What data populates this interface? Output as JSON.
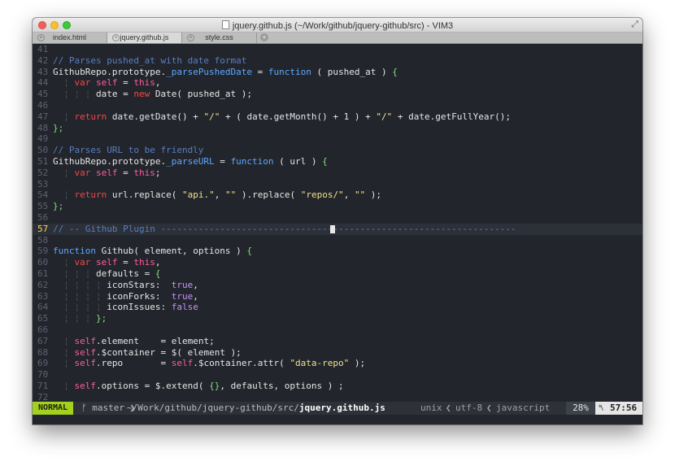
{
  "window": {
    "title": "jquery.github.js (~/Work/github/jquery-github/src) - VIM3"
  },
  "tabs": [
    {
      "label": "index.html"
    },
    {
      "label": "jquery.github.js"
    },
    {
      "label": "style.css"
    }
  ],
  "lines": [
    {
      "num": "41",
      "html": ""
    },
    {
      "num": "42",
      "html": "<span class=\"cmt\">// Parses pushed_at with date format</span>"
    },
    {
      "num": "43",
      "html": "GithubRepo.prototype.<span class=\"fn\">_parsePushedDate</span> = <span class=\"fn\">function</span> ( pushed_at ) <span class=\"brace\">{</span>"
    },
    {
      "num": "44",
      "html": "<span class=\"guide\">  ¦ </span><span class=\"kw\">var</span> <span class=\"self\">self</span> = <span class=\"self\">this</span>,"
    },
    {
      "num": "45",
      "html": "<span class=\"guide\">  ¦ ¦ ¦ </span>date = <span class=\"kw\">new</span> Date( pushed_at );"
    },
    {
      "num": "46",
      "html": ""
    },
    {
      "num": "47",
      "html": "<span class=\"guide\">  ¦ </span><span class=\"kw\">return</span> date.getDate() + <span class=\"str\">\"/\"</span> + ( date.getMonth() + 1 ) + <span class=\"str\">\"/\"</span> + date.getFullYear();"
    },
    {
      "num": "48",
      "html": "<span class=\"brace\">};</span>"
    },
    {
      "num": "49",
      "html": ""
    },
    {
      "num": "50",
      "html": "<span class=\"cmt\">// Parses URL to be friendly</span>"
    },
    {
      "num": "51",
      "html": "GithubRepo.prototype.<span class=\"fn\">_parseURL</span> = <span class=\"fn\">function</span> ( url ) <span class=\"brace\">{</span>"
    },
    {
      "num": "52",
      "html": "<span class=\"guide\">  ¦ </span><span class=\"kw\">var</span> <span class=\"self\">self</span> = <span class=\"self\">this</span>;"
    },
    {
      "num": "53",
      "html": ""
    },
    {
      "num": "54",
      "html": "<span class=\"guide\">  ¦ </span><span class=\"kw\">return</span> url.replace( <span class=\"str\">\"api.\"</span>, <span class=\"str\">\"\"</span> ).replace( <span class=\"str\">\"repos/\"</span>, <span class=\"str\">\"\"</span> );"
    },
    {
      "num": "55",
      "html": "<span class=\"brace\">};</span>"
    },
    {
      "num": "56",
      "html": ""
    },
    {
      "num": "57",
      "html": "<span class=\"cmt\">// -- Github Plugin ------------------------------------------------------------------</span>",
      "current": true
    },
    {
      "num": "58",
      "html": ""
    },
    {
      "num": "59",
      "html": "<span class=\"fn\">function</span> Github( element, options ) <span class=\"brace\">{</span>"
    },
    {
      "num": "60",
      "html": "<span class=\"guide\">  ¦ </span><span class=\"kw\">var</span> <span class=\"self\">self</span> = <span class=\"self\">this</span>,"
    },
    {
      "num": "61",
      "html": "<span class=\"guide\">  ¦ ¦ ¦ </span>defaults = <span class=\"brace\">{</span>"
    },
    {
      "num": "62",
      "html": "<span class=\"guide\">  ¦ ¦ ¦ ¦ </span>iconStars:  <span class=\"bool\">true</span>,"
    },
    {
      "num": "63",
      "html": "<span class=\"guide\">  ¦ ¦ ¦ ¦ </span>iconForks:  <span class=\"bool\">true</span>,"
    },
    {
      "num": "64",
      "html": "<span class=\"guide\">  ¦ ¦ ¦ ¦ </span>iconIssues: <span class=\"bool\">false</span>"
    },
    {
      "num": "65",
      "html": "<span class=\"guide\">  ¦ ¦ ¦ </span><span class=\"brace\">};</span>"
    },
    {
      "num": "66",
      "html": ""
    },
    {
      "num": "67",
      "html": "<span class=\"guide\">  ¦ </span><span class=\"self\">self</span>.element    = element;"
    },
    {
      "num": "68",
      "html": "<span class=\"guide\">  ¦ </span><span class=\"self\">self</span>.$container = $( element );"
    },
    {
      "num": "69",
      "html": "<span class=\"guide\">  ¦ </span><span class=\"self\">self</span>.repo       = <span class=\"self\">self</span>.$container.attr( <span class=\"str\">\"data-repo\"</span> );"
    },
    {
      "num": "70",
      "html": ""
    },
    {
      "num": "71",
      "html": "<span class=\"guide\">  ¦ </span><span class=\"self\">self</span>.options = $.extend( <span class=\"brace\">{}</span>, defaults, options ) ;"
    },
    {
      "num": "72",
      "html": ""
    }
  ],
  "status": {
    "mode": "NORMAL",
    "branch_icon": "ᚠ",
    "branch": "master",
    "path_dir": "~/Work/github/jquery-github/src/",
    "path_file": "jquery.github.js",
    "fileformat": "unix",
    "encoding": "utf-8",
    "filetype": "javascript",
    "percent": "28%",
    "line_icon": "␤",
    "position": "57:56",
    "colors": {
      "mode_bg": "#a4d11d"
    }
  }
}
